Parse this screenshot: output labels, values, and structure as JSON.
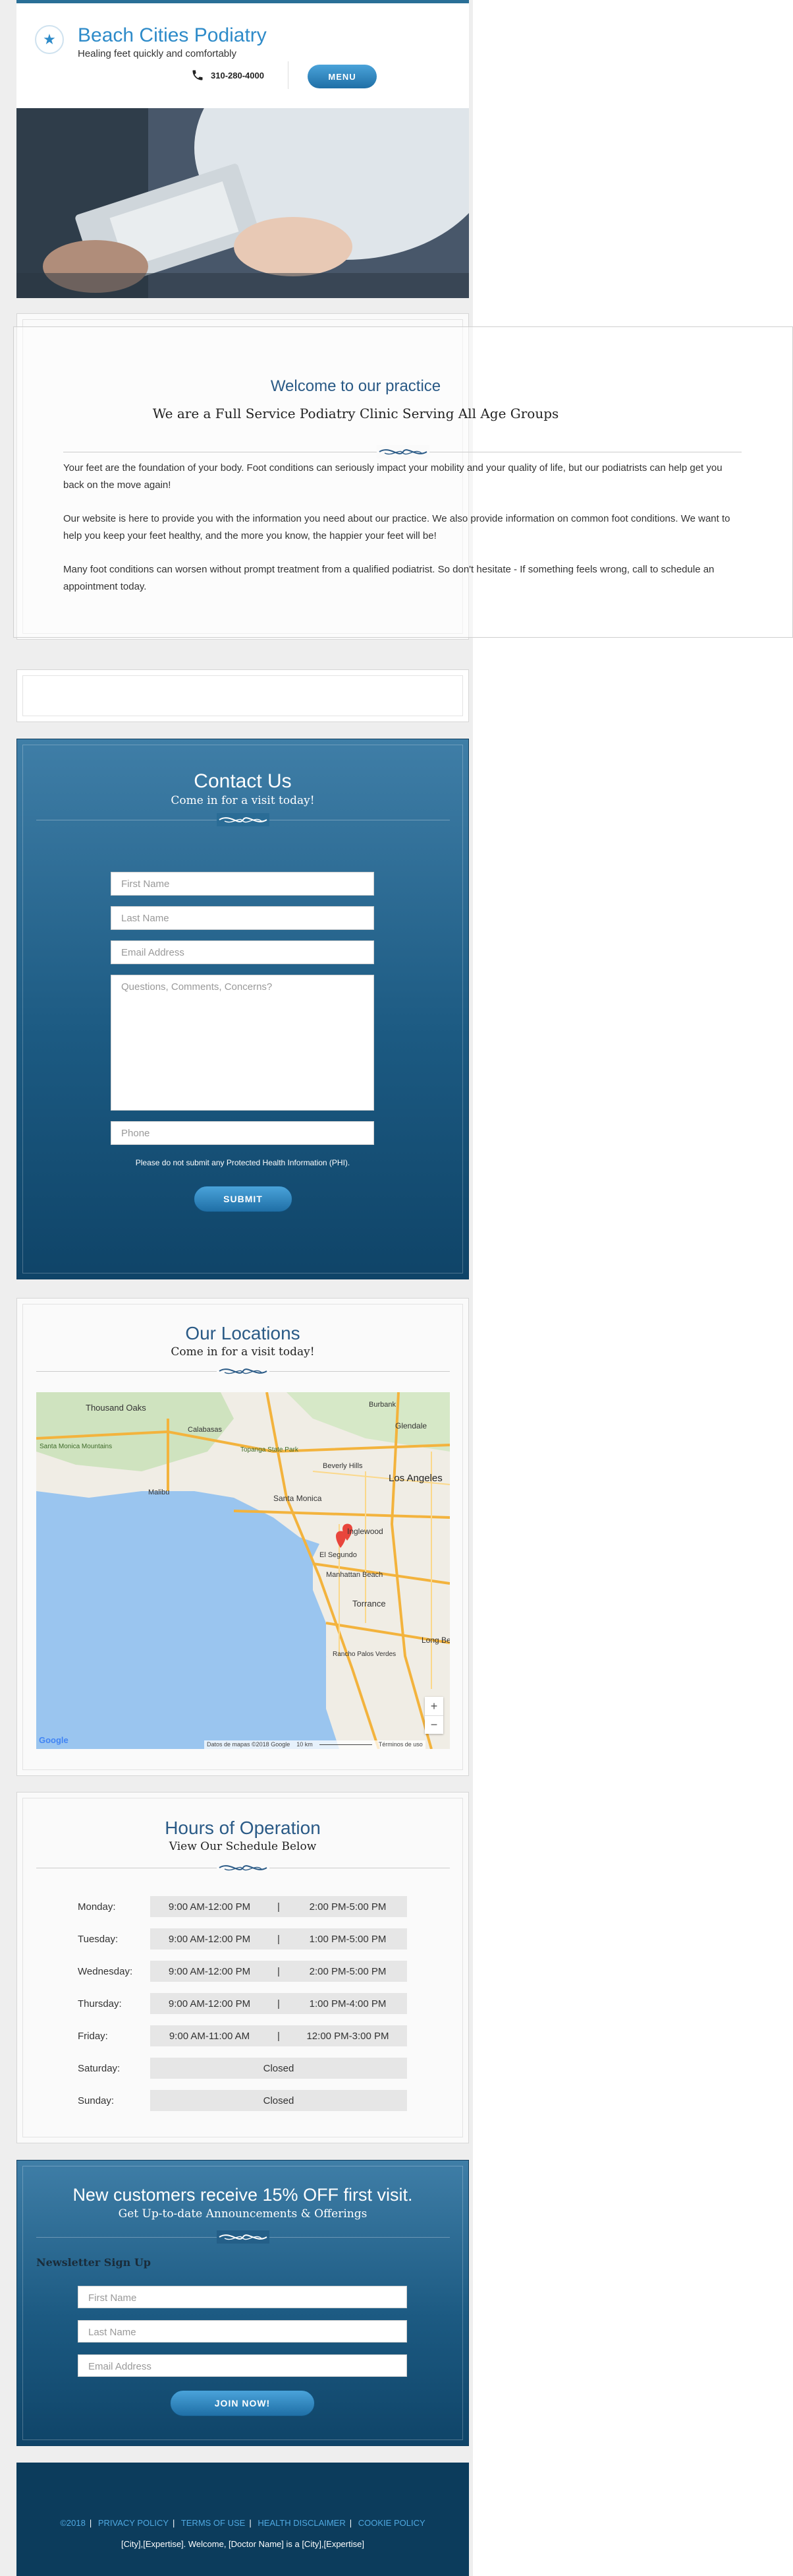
{
  "header": {
    "title": "Beach Cities Podiatry",
    "tagline": "Healing feet quickly and comfortably",
    "phone": "310-280-4000",
    "menu_label": "MENU"
  },
  "welcome": {
    "title": "Welcome to our practice",
    "subtitle": "We are a Full Service Podiatry Clinic Serving All Age Groups",
    "paragraphs": [
      "Your feet are the foundation of your body. Foot conditions can seriously impact your mobility and your quality of life, but our podiatrists can help get you back on the move again!",
      "Our website is here to provide you with the information you need about our practice. We also provide information on common foot conditions. We want to help you keep your feet healthy, and the more you know, the happier your feet will be!",
      "Many foot conditions can worsen without prompt treatment from a qualified podiatrist. So don't hesitate - If something feels wrong, call to schedule an appointment today."
    ]
  },
  "contact": {
    "title": "Contact Us",
    "subtitle": "Come in for a visit today!",
    "first_name": "First Name",
    "last_name": "Last Name",
    "email": "Email Address",
    "comments": "Questions, Comments, Concerns?",
    "phone": "Phone",
    "notice": "Please do not submit any Protected Health Information (PHI).",
    "submit": "SUBMIT"
  },
  "locations": {
    "title": "Our Locations",
    "subtitle": "Come in for a visit today!",
    "map_labels": [
      "Thousand Oaks",
      "Calabasas",
      "Topanga State Park",
      "Malibu",
      "Santa Monica Mountains",
      "Burbank",
      "Glendale",
      "Beverly Hills",
      "Los Angeles",
      "Santa Monica",
      "Inglewood",
      "El Segundo",
      "Manhattan Beach",
      "Torrance",
      "Long Be",
      "Rancho Palos Verdes"
    ],
    "zoom_in": "+",
    "zoom_out": "−",
    "google": "Google",
    "attribution": "Datos de mapas ©2018 Google",
    "scale": "10 km",
    "terms": "Términos de uso"
  },
  "hours": {
    "title": "Hours of Operation",
    "subtitle": "View Our Schedule Below",
    "days": [
      {
        "day": "Monday:",
        "am": "9:00 AM-12:00 PM",
        "sep": "|",
        "pm": "2:00 PM-5:00 PM"
      },
      {
        "day": "Tuesday:",
        "am": "9:00 AM-12:00 PM",
        "sep": "|",
        "pm": "1:00 PM-5:00 PM"
      },
      {
        "day": "Wednesday:",
        "am": "9:00 AM-12:00 PM",
        "sep": "|",
        "pm": "2:00 PM-5:00 PM"
      },
      {
        "day": "Thursday:",
        "am": "9:00 AM-12:00 PM",
        "sep": "|",
        "pm": "1:00 PM-4:00 PM"
      },
      {
        "day": "Friday:",
        "am": "9:00 AM-11:00 AM",
        "sep": "|",
        "pm": "12:00 PM-3:00 PM"
      },
      {
        "day": "Saturday:",
        "closed": "Closed"
      },
      {
        "day": "Sunday:",
        "closed": "Closed"
      }
    ]
  },
  "newsletter": {
    "title": "New customers receive 15% OFF first visit.",
    "subtitle": "Get Up-to-date Announcements & Offerings",
    "label": "Newsletter Sign Up",
    "first_name": "First Name",
    "last_name": "Last Name",
    "email": "Email Address",
    "button": "JOIN NOW!"
  },
  "footer": {
    "links": [
      "©2018",
      "PRIVACY POLICY",
      "TERMS OF USE",
      "HEALTH DISCLAIMER",
      "COOKIE POLICY"
    ],
    "note": "[City],[Expertise]. Welcome, [Doctor Name] is a [City],[Expertise]"
  },
  "colors": {
    "brand_blue": "#2e8bc9",
    "section_blue": "#1c5a82",
    "footer_blue": "#0c3c5c",
    "link_blue": "#4fa8e0"
  }
}
